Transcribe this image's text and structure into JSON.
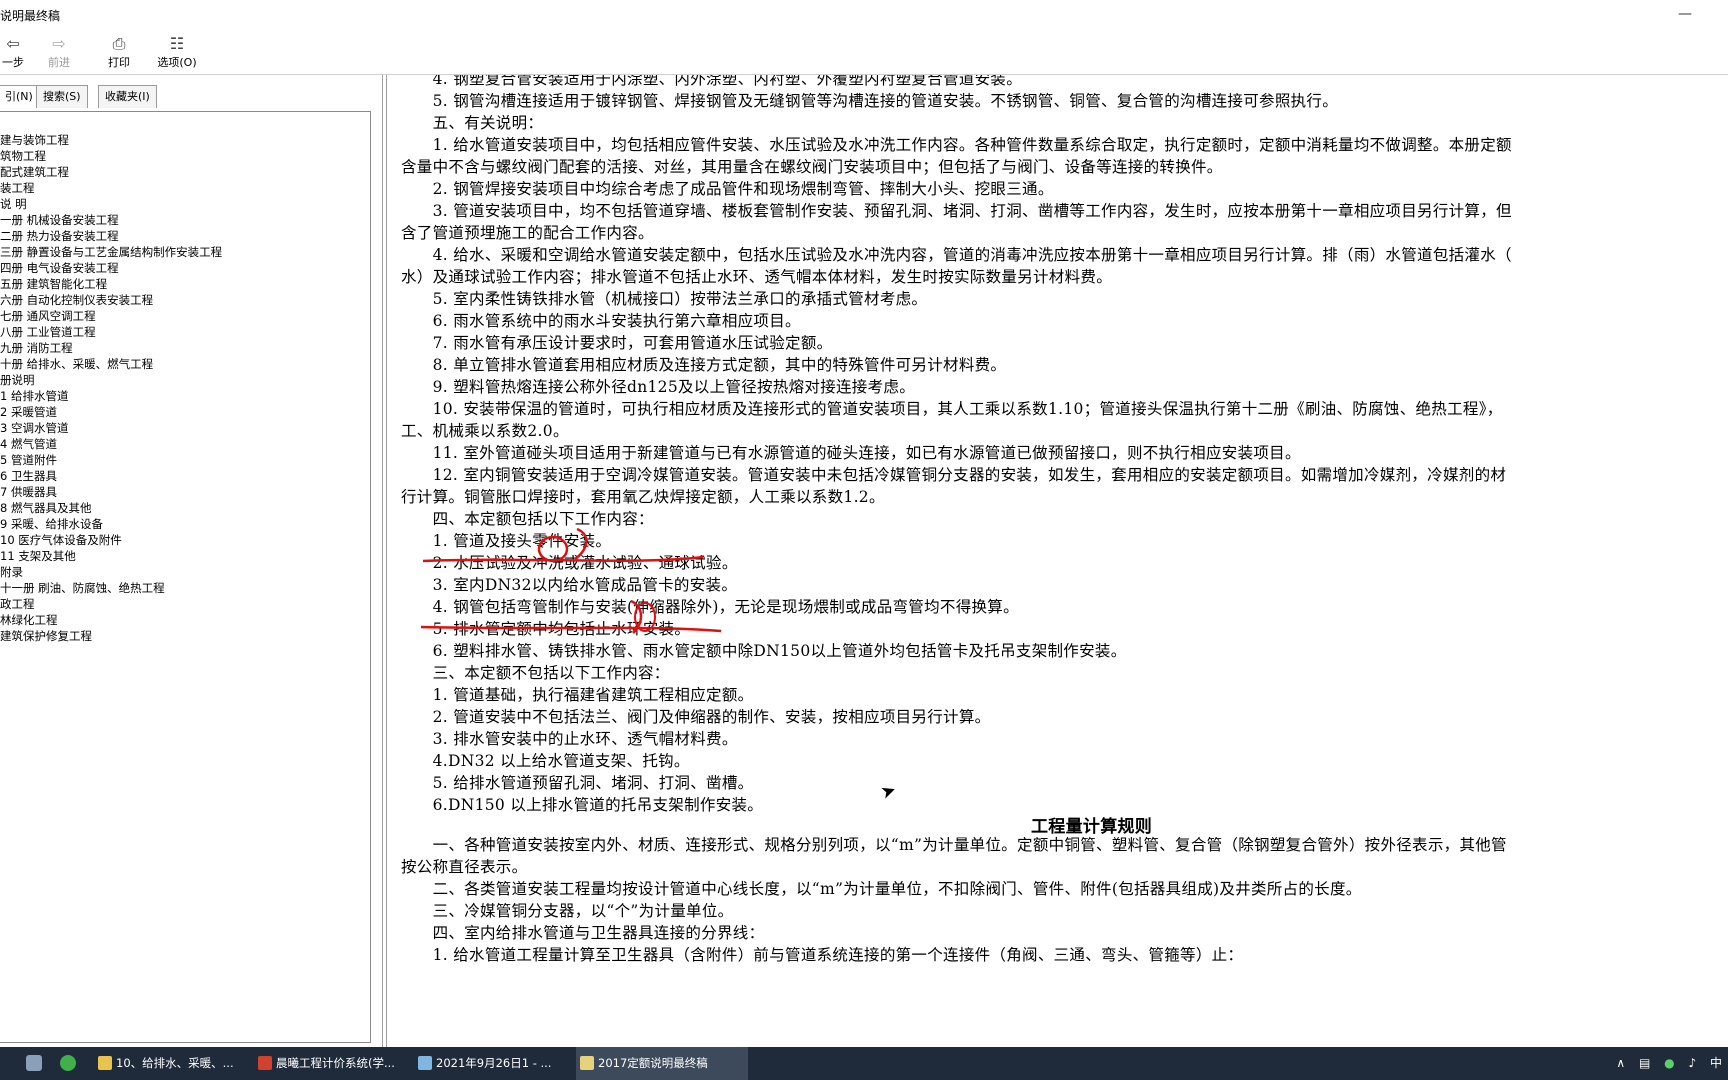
{
  "window": {
    "title": "说明最终稿",
    "minimize_icon": "minimize-icon"
  },
  "toolbar": {
    "back_label": "一步",
    "forward_label": "前进",
    "print_label": "打印",
    "options_label": "选项(O)"
  },
  "left_tabs": {
    "index_label": "引(N)",
    "search_label": "搜索(S)",
    "favorites_label": "收藏夹(I)"
  },
  "tree": [
    "建与装饰工程",
    "筑物工程",
    "配式建筑工程",
    "装工程",
    "说 明",
    "一册 机械设备安装工程",
    "二册 热力设备安装工程",
    "三册 静置设备与工艺金属结构制作安装工程",
    "四册 电气设备安装工程",
    "五册 建筑智能化工程",
    "六册 自动化控制仪表安装工程",
    "七册 通风空调工程",
    "八册 工业管道工程",
    "九册 消防工程",
    "十册 给排水、采暖、燃气工程",
    "册说明",
    "1 给排水管道",
    "2 采暖管道",
    "3 空调水管道",
    "4 燃气管道",
    "5 管道附件",
    "6 卫生器具",
    "7 供暖器具",
    "8 燃气器具及其他",
    "9 采暖、给排水设备",
    "10 医疗气体设备及附件",
    "11 支架及其他",
    "附录",
    "十一册 刷油、防腐蚀、绝热工程",
    "政工程",
    "林绿化工程",
    "建筑保护修复工程"
  ],
  "doc": {
    "lines": [
      "　　4. 钢塑复合管安装适用于内涂塑、内外涂塑、内衬塑、外覆塑内衬塑复合管道安装。",
      "　　5. 钢管沟槽连接适用于镀锌钢管、焊接钢管及无缝钢管等沟槽连接的管道安装。不锈钢管、铜管、复合管的沟槽连接可参照执行。",
      "　　五、有关说明：",
      "　　1. 给水管道安装项目中，均包括相应管件安装、水压试验及水冲洗工作内容。各种管件数量系综合取定，执行定额时，定额中消耗量均不做调整。本册定额",
      "含量中不含与螺纹阀门配套的活接、对丝，其用量含在螺纹阀门安装项目中；但包括了与阀门、设备等连接的转换件。",
      "　　2. 钢管焊接安装项目中均综合考虑了成品管件和现场煨制弯管、摔制大小头、挖眼三通。",
      "　　3. 管道安装项目中，均不包括管道穿墙、楼板套管制作安装、预留孔洞、堵洞、打洞、凿槽等工作内容，发生时，应按本册第十一章相应项目另行计算，但",
      "含了管道预埋施工的配合工作内容。",
      "　　4. 给水、采暖和空调给水管道安装定额中，包括水压试验及水冲洗内容，管道的消毒冲洗应按本册第十一章相应项目另行计算。排（雨）水管道包括灌水（",
      "水）及通球试验工作内容；排水管道不包括止水环、透气帽本体材料，发生时按实际数量另计材料费。",
      "　　5. 室内柔性铸铁排水管（机械接口）按带法兰承口的承插式管材考虑。",
      "　　6. 雨水管系统中的雨水斗安装执行第六章相应项目。",
      "　　7. 雨水管有承压设计要求时，可套用管道水压试验定额。",
      "　　8. 单立管排水管道套用相应材质及连接方式定额，其中的特殊管件可另计材料费。",
      "　　9. 塑料管热熔连接公称外径dn125及以上管径按热熔对接连接考虑。",
      "　　10. 安装带保温的管道时，可执行相应材质及连接形式的管道安装项目，其人工乘以系数1.10；管道接头保温执行第十二册《刷油、防腐蚀、绝热工程》，",
      "工、机械乘以系数2.0。",
      "　　11. 室外管道碰头项目适用于新建管道与已有水源管道的碰头连接，如已有水源管道已做预留接口，则不执行相应安装项目。",
      "　　12. 室内铜管安装适用于空调冷媒管道安装。管道安装中未包括冷媒管铜分支器的安装，如发生，套用相应的安装定额项目。如需增加冷媒剂，冷媒剂的材",
      "行计算。铜管胀口焊接时，套用氧乙炔焊接定额，人工乘以系数1.2。",
      "　　四、本定额包括以下工作内容：",
      "　　1. 管道及接头零件安装。",
      "　　2. 水压试验及冲洗或灌水试验、通球试验。",
      "　　3. 室内DN32以内给水管成品管卡的安装。",
      "　　4. 钢管包括弯管制作与安装(伸缩器除外)，无论是现场煨制或成品弯管均不得换算。",
      "　　5. 排水管定额中均包括止水环安装。",
      "　　6. 塑料排水管、铸铁排水管、雨水管定额中除DN150以上管道外均包括管卡及托吊支架制作安装。",
      "　　三、本定额不包括以下工作内容：",
      "　　1. 管道基础，执行福建省建筑工程相应定额。",
      "　　2. 管道安装中不包括法兰、阀门及伸缩器的制作、安装，按相应项目另行计算。",
      "　　3. 排水管安装中的止水环、透气帽材料费。",
      "　　4.DN32 以上给水管道支架、托钩。",
      "　　5. 给排水管道预留孔洞、堵洞、打洞、凿槽。",
      "　　6.DN150 以上排水管道的托吊支架制作安装。"
    ],
    "rules_heading": "工程量计算规则",
    "rules_lines": [
      "　　一、各种管道安装按室内外、材质、连接形式、规格分别列项，以“m”为计量单位。定额中铜管、塑料管、复合管（除钢塑复合管外）按外径表示，其他管",
      "按公称直径表示。",
      "　　二、各类管道安装工程量均按设计管道中心线长度，以“m”为计量单位，不扣除阀门、管件、附件(包括器具组成)及井类所占的长度。",
      "　　三、冷媒管铜分支器，以“个”为计量单位。",
      "　　四、室内给排水管道与卫生器具连接的分界线：",
      "　　1. 给水管道工程量计算至卫生器具（含附件）前与管道系统连接的第一个连接件（角阀、三通、弯头、管箍等）止："
    ]
  },
  "annotation_color": "#e01010",
  "taskbar": {
    "apps": [
      "10、给排水、采暖、...",
      "晨曦工程计价系统(学...",
      "2021年9月26日1 - ...",
      "2017定额说明最终稿"
    ],
    "tray_text": "中"
  }
}
